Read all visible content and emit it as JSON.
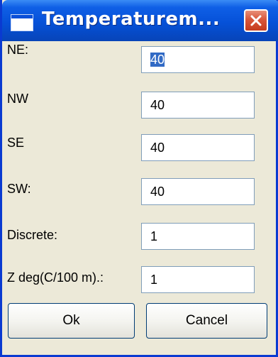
{
  "window": {
    "title": "Temperaturem..."
  },
  "fields": [
    {
      "label": "NE:",
      "value": "40"
    },
    {
      "label": "NW",
      "value": "40"
    },
    {
      "label": "SE",
      "value": "40"
    },
    {
      "label": "SW:",
      "value": "40"
    },
    {
      "label": "Discrete:",
      "value": "1"
    },
    {
      "label": "Z deg(C/100 m).:",
      "value": "1"
    }
  ],
  "buttons": {
    "ok": "Ok",
    "cancel": "Cancel"
  },
  "icons": {
    "window": "window-icon",
    "close": "close-icon"
  },
  "colors": {
    "titlebar": "#0651d8",
    "close": "#d8563a",
    "dialog_bg": "#ece9d8",
    "selection": "#316ac5"
  }
}
